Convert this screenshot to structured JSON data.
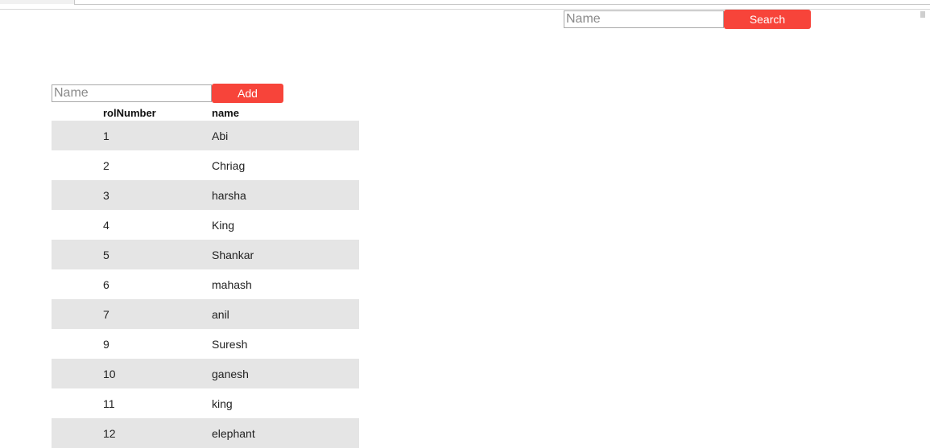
{
  "search": {
    "placeholder": "Name",
    "button_label": "Search"
  },
  "add_form": {
    "placeholder": "Name",
    "button_label": "Add"
  },
  "table": {
    "columns": [
      "rolNumber",
      "name"
    ],
    "rows": [
      {
        "rolNumber": "1",
        "name": "Abi"
      },
      {
        "rolNumber": "2",
        "name": "Chriag"
      },
      {
        "rolNumber": "3",
        "name": "harsha"
      },
      {
        "rolNumber": "4",
        "name": "King"
      },
      {
        "rolNumber": "5",
        "name": "Shankar"
      },
      {
        "rolNumber": "6",
        "name": "mahash"
      },
      {
        "rolNumber": "7",
        "name": "anil"
      },
      {
        "rolNumber": "9",
        "name": "Suresh"
      },
      {
        "rolNumber": "10",
        "name": "ganesh"
      },
      {
        "rolNumber": "11",
        "name": "king"
      },
      {
        "rolNumber": "12",
        "name": "elephant"
      }
    ]
  },
  "colors": {
    "accent": "#f7443a",
    "row_shade": "#e5e5e5"
  }
}
